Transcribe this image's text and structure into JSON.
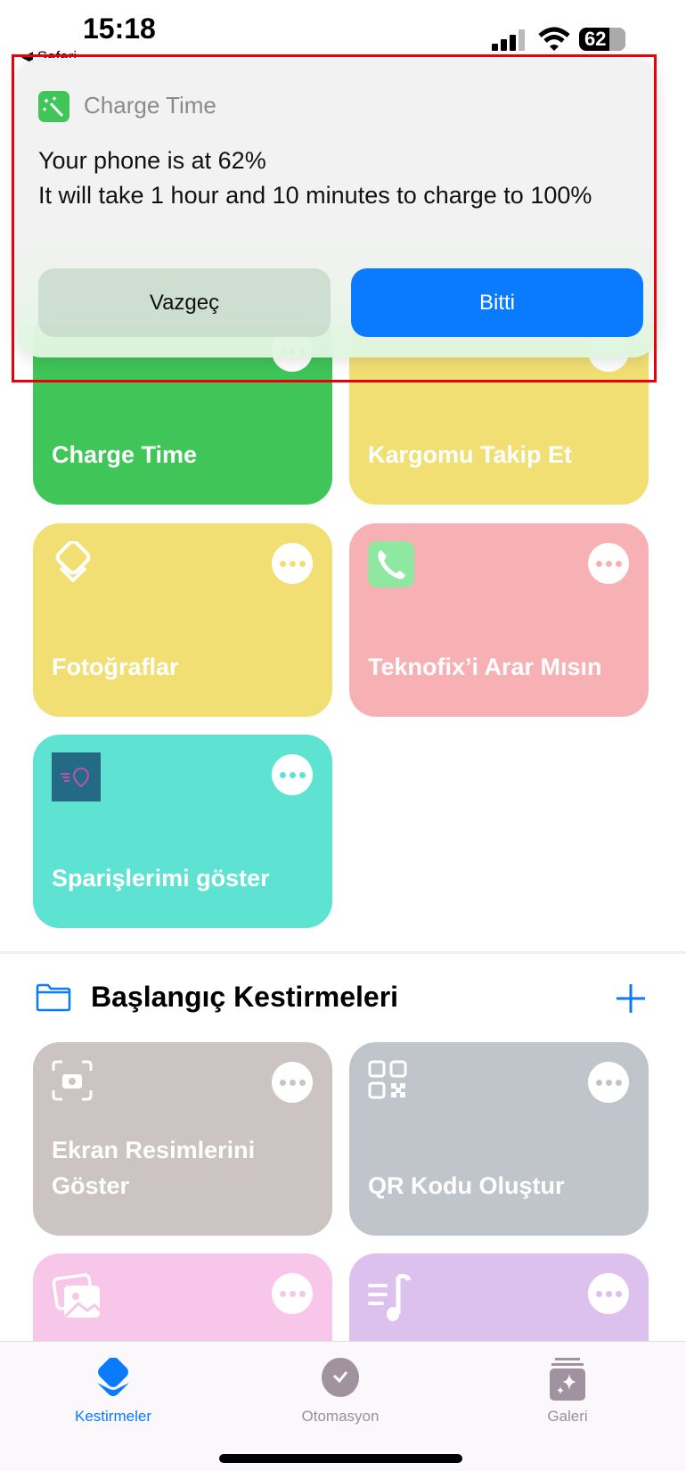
{
  "status_bar": {
    "time": "15:18",
    "back_app": "◀ Safari",
    "battery": "62"
  },
  "notification": {
    "app_name": "Charge Time",
    "app_icon": "magic-wand-icon",
    "body_lines": [
      "Your phone is at 62%",
      "It will take 1 hour and 10 minutes to charge to 100%"
    ],
    "cancel_label": "Vazgeç",
    "done_label": "Bitti",
    "accent": "#0a7aff"
  },
  "shortcuts": [
    {
      "title": "Charge Time",
      "color": "#3fc558",
      "icon": "magic-wand-icon"
    },
    {
      "title": "Kargomu Takip Et",
      "color": "#f2df74",
      "icon": "layers-icon"
    },
    {
      "title": "Fotoğraflar",
      "color": "#f2df74",
      "icon": "layers-icon"
    },
    {
      "title": "Teknofix’i Arar Mısın",
      "color": "#f7b0b3",
      "icon": "phone-icon"
    },
    {
      "title": "Sparişlerimi göster",
      "color": "#5ee3d3",
      "icon": "delivery-pin-icon"
    }
  ],
  "folder": {
    "title": "Başlangıç Kestirmeleri",
    "icon": "folder-icon",
    "add_icon": "plus-icon"
  },
  "starter_shortcuts": [
    {
      "title": "Ekran Resimlerini Göster",
      "color": "#cbc4c3",
      "icon": "screenshot-camera-icon"
    },
    {
      "title": "QR Kodu Oluştur",
      "color": "#c0c5cc",
      "icon": "qr-code-icon"
    },
    {
      "title": "",
      "color": "#f8c6e8",
      "icon": "photos-icon"
    },
    {
      "title": "",
      "color": "#dcc0ee",
      "icon": "music-list-icon"
    }
  ],
  "tabs": [
    {
      "label": "Kestirmeler",
      "active": true,
      "icon": "layers-icon"
    },
    {
      "label": "Otomasyon",
      "active": false,
      "icon": "clock-check-icon"
    },
    {
      "label": "Galeri",
      "active": false,
      "icon": "gallery-sparkle-icon"
    }
  ]
}
